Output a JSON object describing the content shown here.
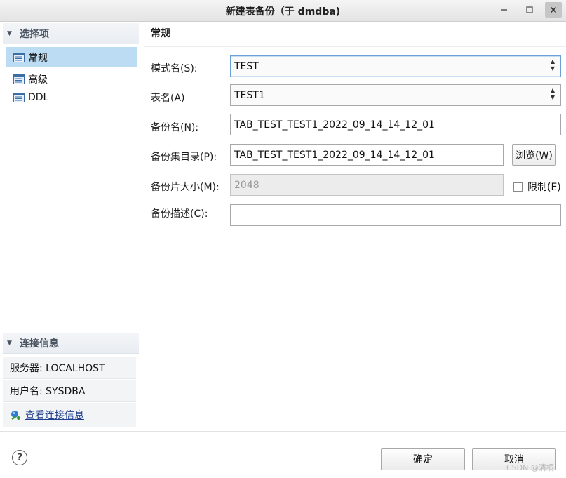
{
  "window": {
    "title": "新建表备份（于 dmdba)"
  },
  "sidebar": {
    "section_title": "选择项",
    "items": [
      {
        "label": "常规",
        "selected": true
      },
      {
        "label": "高级",
        "selected": false
      },
      {
        "label": "DDL",
        "selected": false
      }
    ]
  },
  "connection": {
    "section_title": "连接信息",
    "server": "服务器: LOCALHOST",
    "user": "用户名: SYSDBA",
    "view_link": "查看连接信息"
  },
  "page": {
    "title": "常规"
  },
  "form": {
    "schema": {
      "label": "模式名(S):",
      "value": "TEST"
    },
    "table": {
      "label": "表名(A)",
      "value": "TEST1"
    },
    "backup_name": {
      "label": "备份名(N):",
      "value": "TAB_TEST_TEST1_2022_09_14_14_12_01"
    },
    "backup_dir": {
      "label": "备份集目录(P):",
      "value": "TAB_TEST_TEST1_2022_09_14_14_12_01",
      "browse_label": "浏览(W)"
    },
    "piece_size": {
      "label": "备份片大小(M):",
      "value": "2048",
      "limit_label": "限制(E)",
      "limit_checked": false
    },
    "description": {
      "label": "备份描述(C):",
      "value": ""
    }
  },
  "footer": {
    "ok_label": "确定",
    "cancel_label": "取消",
    "help_symbol": "?",
    "watermark": "CSDN @清桐"
  },
  "colors": {
    "selection": "#bcdcf3",
    "link": "#1f3f8f",
    "focus_border": "#6aa0d8"
  }
}
